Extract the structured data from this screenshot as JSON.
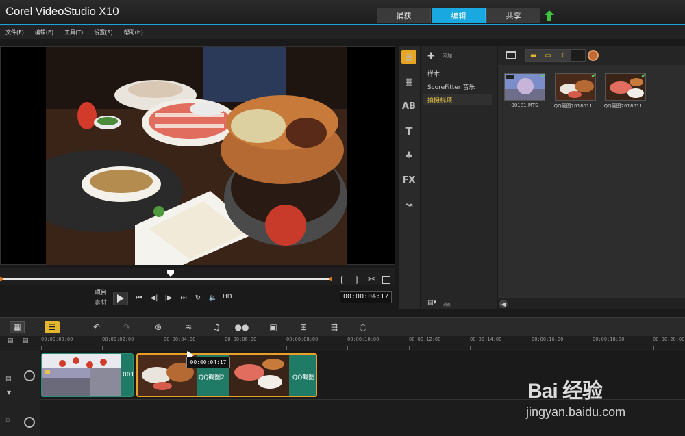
{
  "window": {
    "app_title": "Corel VideoStudio X10",
    "tabs": [
      {
        "label": "捕获",
        "active": false
      },
      {
        "label": "编辑",
        "active": true
      },
      {
        "label": "共享",
        "active": false
      }
    ]
  },
  "menu": {
    "items": [
      "文件(F)",
      "编辑(E)",
      "工具(T)",
      "设置(S)",
      "帮助(H)"
    ]
  },
  "player": {
    "mode_project": "项目",
    "mode_clip": "素材",
    "hd_label": "HD",
    "timecode": "00:00:04:17",
    "mark_in": "[",
    "mark_out": "]"
  },
  "library": {
    "add_label": "添加",
    "browse_label": "浏览",
    "nav_items": [
      {
        "label": "样本",
        "selected": false
      },
      {
        "label": "ScoreFitter 音乐",
        "selected": false
      },
      {
        "label": "拍摄视频",
        "selected": true
      }
    ],
    "thumbnails": [
      {
        "name": "00181.MTS",
        "checked": true
      },
      {
        "name": "QQ截图2018011...",
        "checked": true
      },
      {
        "name": "QQ截图2018011...",
        "checked": true
      }
    ]
  },
  "timeline": {
    "ruler": [
      "00:00:00:00",
      "00:00:02:00",
      "00:00:04:00",
      "00:00:06:00",
      "00:00:08:00",
      "00:00:10:00",
      "00:00:12:00",
      "00:00:14:00",
      "00:00:16:00",
      "00:00:18:00",
      "00:00:20:00"
    ],
    "playhead_time": "00:00:04:17",
    "clips": [
      {
        "label": "001"
      },
      {
        "label": "QQ截图2"
      },
      {
        "label": "QQ截图"
      }
    ]
  },
  "watermark": {
    "brand": "Bai 经验",
    "url": "jingyan.baidu.com"
  },
  "colors": {
    "accent": "#19a8e0",
    "clip_green": "#1f7a66",
    "selection_orange": "#e7a521"
  }
}
